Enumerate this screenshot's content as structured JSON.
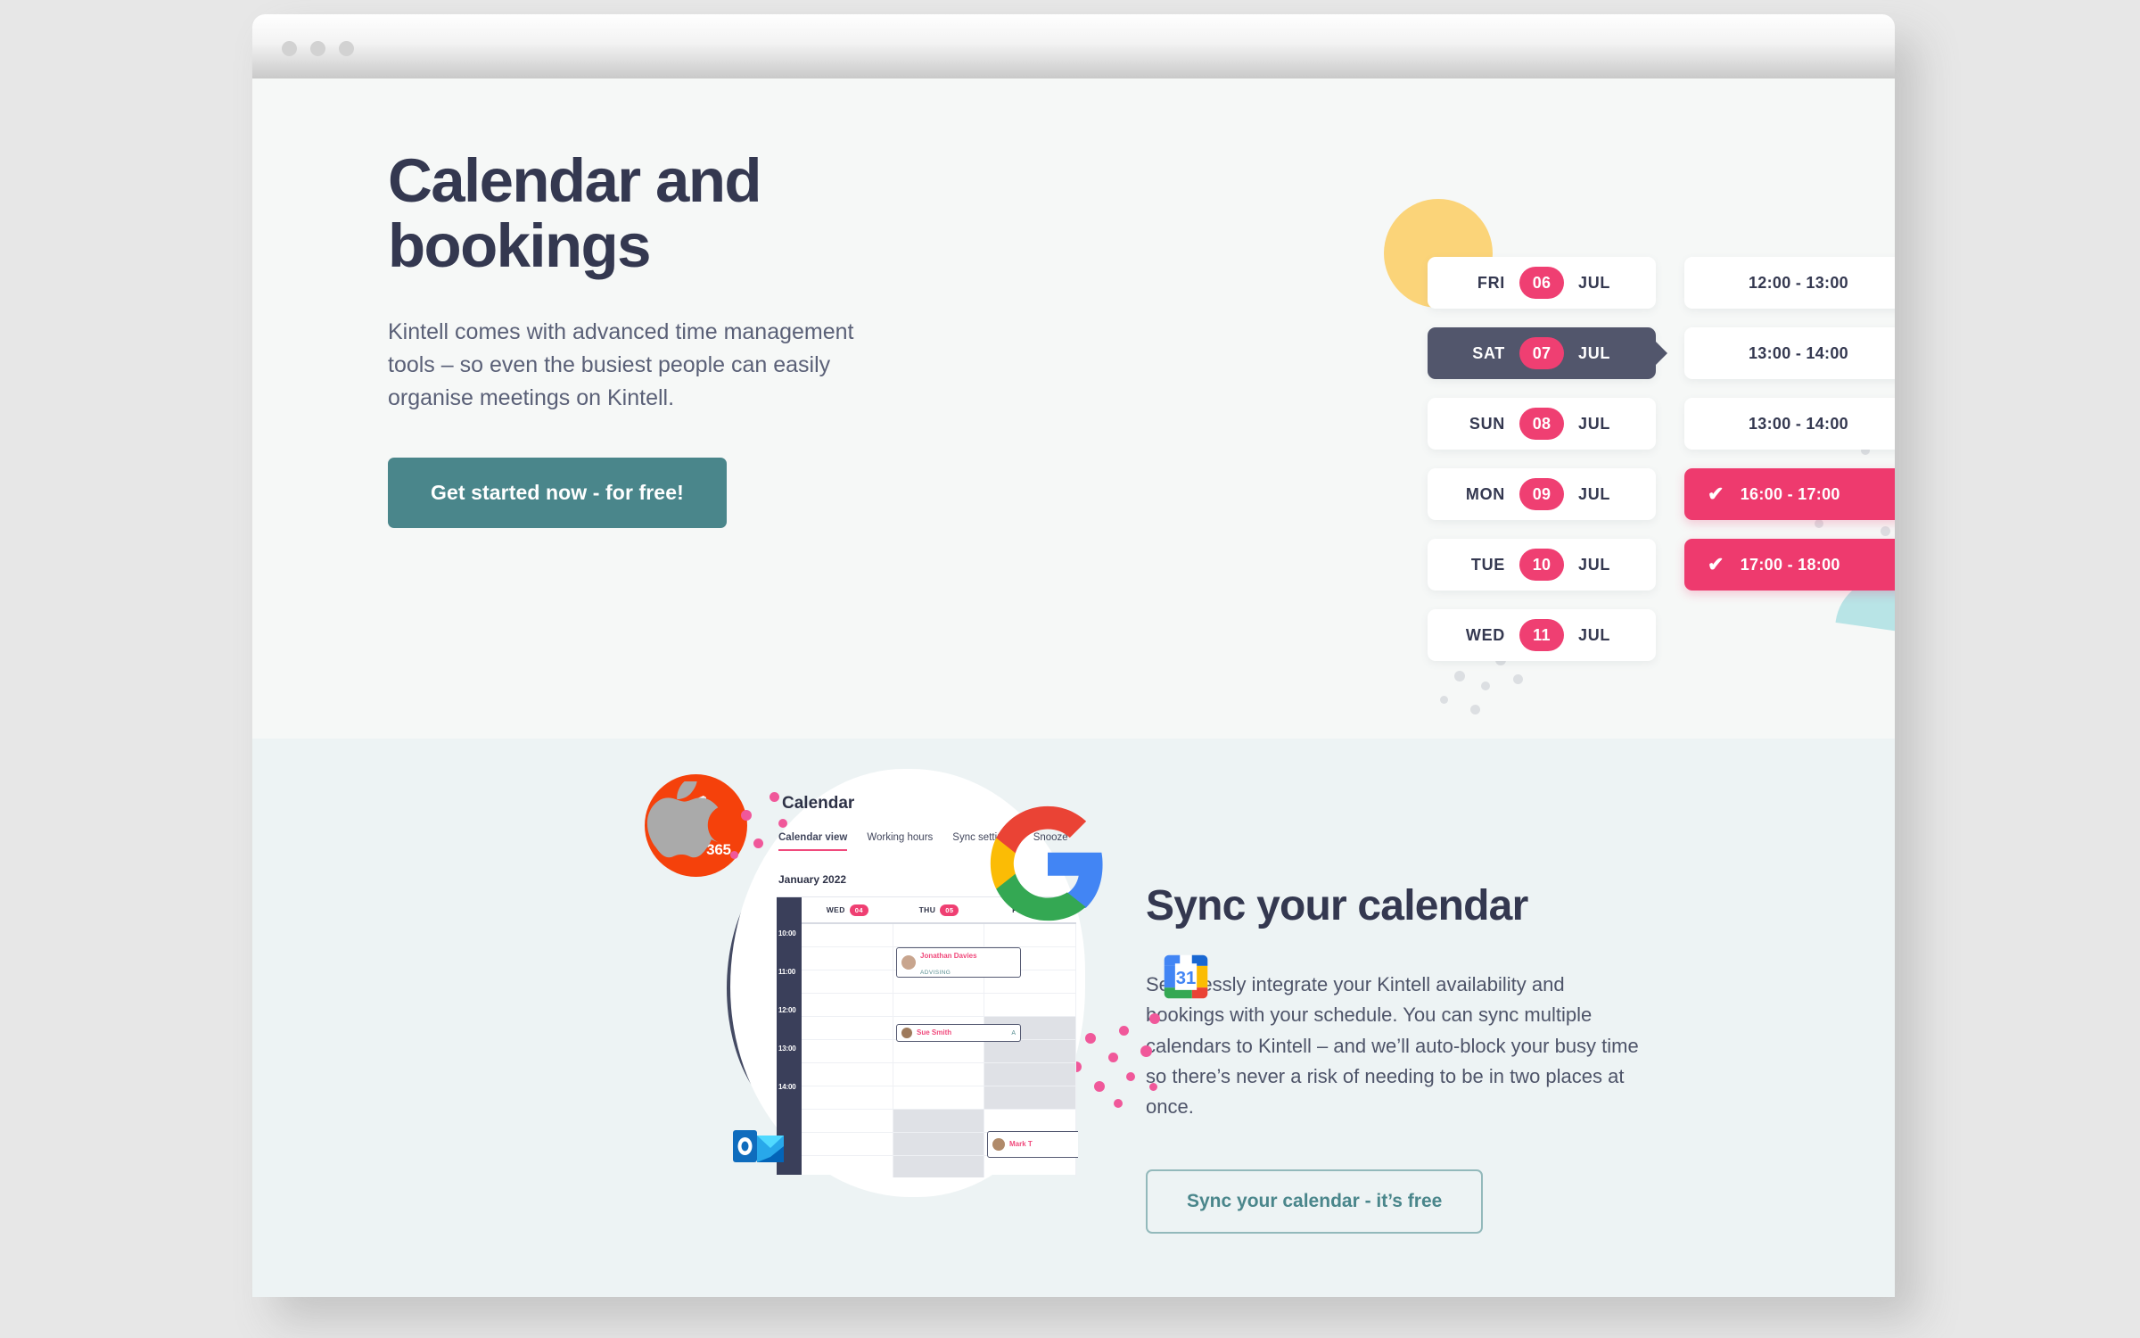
{
  "window": {
    "traffic_lights": [
      "close",
      "minimize",
      "maximize"
    ]
  },
  "colors": {
    "heading": "#343850",
    "body_text": "#5a6077",
    "primary_button": "#4a868b",
    "accent_pink": "#ef3f72",
    "dark_pill": "#52566c",
    "hero_bg": "#f6f8f7",
    "sync_bg": "#edf3f4",
    "yellow_shape": "#fbd479",
    "mint_shape": "#b8e4e6",
    "page_bg": "#e7e7e7"
  },
  "hero": {
    "title_line1": "Calendar and",
    "title_line2": "bookings",
    "body": "Kintell comes with advanced time management tools – so even the busiest people can easily organise meetings on Kintell.",
    "cta_label": "Get started now - for free!"
  },
  "calendar_widget": {
    "days": [
      {
        "dow": "FRI",
        "num": "06",
        "mon": "JUL",
        "active": false
      },
      {
        "dow": "SAT",
        "num": "07",
        "mon": "JUL",
        "active": true
      },
      {
        "dow": "SUN",
        "num": "08",
        "mon": "JUL",
        "active": false
      },
      {
        "dow": "MON",
        "num": "09",
        "mon": "JUL",
        "active": false
      },
      {
        "dow": "TUE",
        "num": "10",
        "mon": "JUL",
        "active": false
      },
      {
        "dow": "WED",
        "num": "11",
        "mon": "JUL",
        "active": false
      }
    ],
    "slots": [
      {
        "label": "12:00 - 13:00",
        "selected": false
      },
      {
        "label": "13:00 - 14:00",
        "selected": false
      },
      {
        "label": "13:00 - 14:00",
        "selected": false
      },
      {
        "label": "16:00 - 17:00",
        "selected": true
      },
      {
        "label": "17:00 - 18:00",
        "selected": true
      }
    ],
    "check_glyph": "✔"
  },
  "sync": {
    "title": "Sync your calendar",
    "body": "Seamlessly integrate your Kintell availability and bookings with your schedule. You can sync multiple calendars to Kintell – and we’ll auto-block your busy time so there’s never a risk of needing to be in two places at once.",
    "cta_label": "Sync your calendar - it’s free"
  },
  "illustration": {
    "app_title": "Calendar",
    "tabs": [
      {
        "label": "Calendar view",
        "active": true
      },
      {
        "label": "Working hours",
        "active": false
      },
      {
        "label": "Sync settings",
        "active": false
      },
      {
        "label": "Snooze",
        "active": false
      }
    ],
    "month": "January 2022",
    "day_headers": [
      {
        "dow": "WED",
        "num": "04"
      },
      {
        "dow": "THU",
        "num": "05"
      },
      {
        "dow": "FRI",
        "num": "06"
      }
    ],
    "times": [
      "10:00",
      "11:00",
      "12:00",
      "13:00",
      "14:00"
    ],
    "events": [
      {
        "name": "Jonathan Davies",
        "sub": "ADVISING",
        "right": ""
      },
      {
        "name": "Sue Smith",
        "sub": "",
        "right": "A"
      },
      {
        "name": "Mark T",
        "sub": "",
        "right": ""
      }
    ],
    "logos": [
      {
        "name": "apple-logo"
      },
      {
        "name": "google-logo"
      },
      {
        "name": "google-calendar-logo",
        "label": "31"
      },
      {
        "name": "office-365-logo",
        "label": "Office 365"
      },
      {
        "name": "outlook-logo"
      }
    ]
  }
}
